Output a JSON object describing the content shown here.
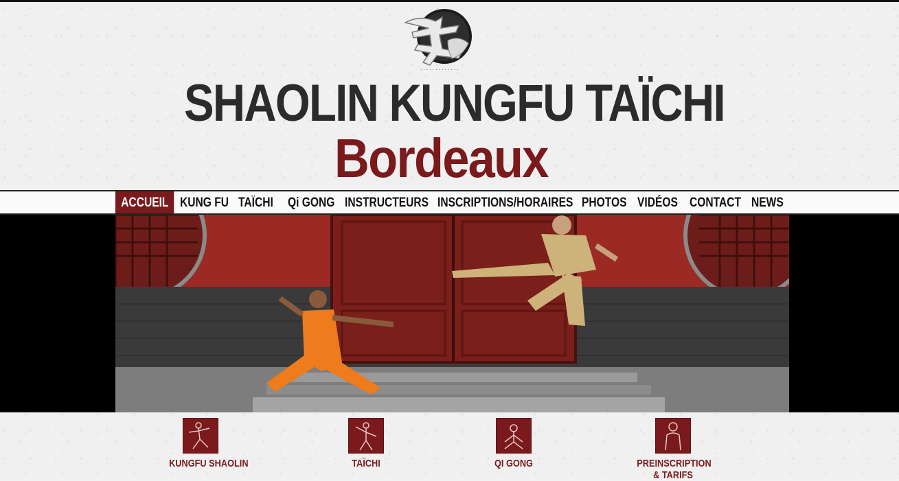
{
  "header": {
    "title": "SHAOLIN KUNGFU TAÏCHI",
    "city": "Bordeaux",
    "logo_icon": "wu-calligraphy-logo"
  },
  "nav": {
    "items": [
      {
        "label": "ACCUEIL",
        "active": true
      },
      {
        "label": "KUNG FU",
        "active": false
      },
      {
        "label": "TAÏCHI",
        "active": false
      },
      {
        "label": "Qi GONG",
        "active": false
      },
      {
        "label": "INSTRUCTEURS",
        "active": false
      },
      {
        "label": "INSCRIPTIONS/HORAIRES",
        "active": false
      },
      {
        "label": "PHOTOS",
        "active": false
      },
      {
        "label": "VIDÉOS",
        "active": false
      },
      {
        "label": "CONTACT",
        "active": false
      },
      {
        "label": "NEWS",
        "active": false
      }
    ]
  },
  "hero": {
    "image": "shaolin-monks-fighting-in-front-of-temple-door"
  },
  "features": [
    {
      "label": "KUNGFU SHAOLIN",
      "icon": "kungfu-figure-icon"
    },
    {
      "label": "TAÏCHI",
      "icon": "taichi-figure-icon"
    },
    {
      "label": "QI GONG",
      "icon": "qigong-figure-icon"
    },
    {
      "label": "PREINSCRIPTION\n& TARIFS",
      "label_line1": "PREINSCRIPTION",
      "label_line2": "& TARIFS",
      "icon": "monk-figure-icon"
    }
  ],
  "colors": {
    "brand_red": "#7a1a1c",
    "title_dark": "#2b2b2b"
  }
}
